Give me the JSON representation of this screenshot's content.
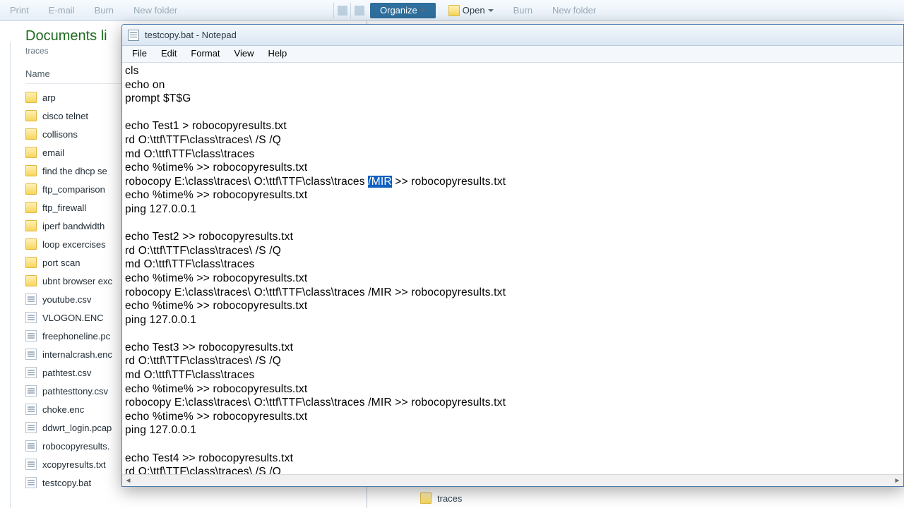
{
  "toolbar_left": {
    "print": "Print",
    "email": "E-mail",
    "burn": "Burn",
    "new_folder": "New folder"
  },
  "toolbar_right": {
    "organize": "Organize",
    "open": "Open",
    "burn": "Burn",
    "new_folder": "New folder"
  },
  "left_explorer": {
    "library_title": "Documents li",
    "library_sub": "traces",
    "column_name": "Name",
    "files": [
      {
        "icon": "folder",
        "name": "arp"
      },
      {
        "icon": "folder",
        "name": "cisco telnet"
      },
      {
        "icon": "folder",
        "name": "collisons"
      },
      {
        "icon": "folder",
        "name": "email"
      },
      {
        "icon": "folder",
        "name": "find the dhcp se"
      },
      {
        "icon": "folder",
        "name": "ftp_comparison"
      },
      {
        "icon": "folder",
        "name": "ftp_firewall"
      },
      {
        "icon": "folder",
        "name": "iperf bandwidth"
      },
      {
        "icon": "folder",
        "name": "loop excercises"
      },
      {
        "icon": "folder",
        "name": "port scan"
      },
      {
        "icon": "folder",
        "name": "ubnt browser exc"
      },
      {
        "icon": "csv",
        "name": "youtube.csv"
      },
      {
        "icon": "enc",
        "name": "VLOGON.ENC"
      },
      {
        "icon": "pcap",
        "name": "freephoneline.pc"
      },
      {
        "icon": "enc",
        "name": "internalcrash.enc"
      },
      {
        "icon": "csv",
        "name": "pathtest.csv"
      },
      {
        "icon": "csv",
        "name": "pathtesttony.csv"
      },
      {
        "icon": "enc",
        "name": "choke.enc"
      },
      {
        "icon": "pcap",
        "name": "ddwrt_login.pcap"
      },
      {
        "icon": "txt",
        "name": "robocopyresults."
      },
      {
        "icon": "txt",
        "name": "xcopyresults.txt"
      },
      {
        "icon": "bat",
        "name": "testcopy.bat"
      }
    ]
  },
  "right_hint": "traces",
  "notepad": {
    "title": "testcopy.bat - Notepad",
    "menu": {
      "file": "File",
      "edit": "Edit",
      "format": "Format",
      "view": "View",
      "help": "Help"
    },
    "lines_before_sel": "cls\necho on\nprompt $T$G\n\necho Test1 > robocopyresults.txt\nrd O:\\ttf\\TTF\\class\\traces\\ /S /Q\nmd O:\\ttf\\TTF\\class\\traces\necho %time% >> robocopyresults.txt\nrobocopy E:\\class\\traces\\ O:\\ttf\\TTF\\class\\traces ",
    "selection": "/MIR",
    "lines_after_sel": " >> robocopyresults.txt\necho %time% >> robocopyresults.txt\nping 127.0.0.1\n\necho Test2 >> robocopyresults.txt\nrd O:\\ttf\\TTF\\class\\traces\\ /S /Q\nmd O:\\ttf\\TTF\\class\\traces\necho %time% >> robocopyresults.txt\nrobocopy E:\\class\\traces\\ O:\\ttf\\TTF\\class\\traces /MIR >> robocopyresults.txt\necho %time% >> robocopyresults.txt\nping 127.0.0.1\n\necho Test3 >> robocopyresults.txt\nrd O:\\ttf\\TTF\\class\\traces\\ /S /Q\nmd O:\\ttf\\TTF\\class\\traces\necho %time% >> robocopyresults.txt\nrobocopy E:\\class\\traces\\ O:\\ttf\\TTF\\class\\traces /MIR >> robocopyresults.txt\necho %time% >> robocopyresults.txt\nping 127.0.0.1\n\necho Test4 >> robocopyresults.txt\nrd O:\\ttf\\TTF\\class\\traces\\ /S /Q"
  }
}
